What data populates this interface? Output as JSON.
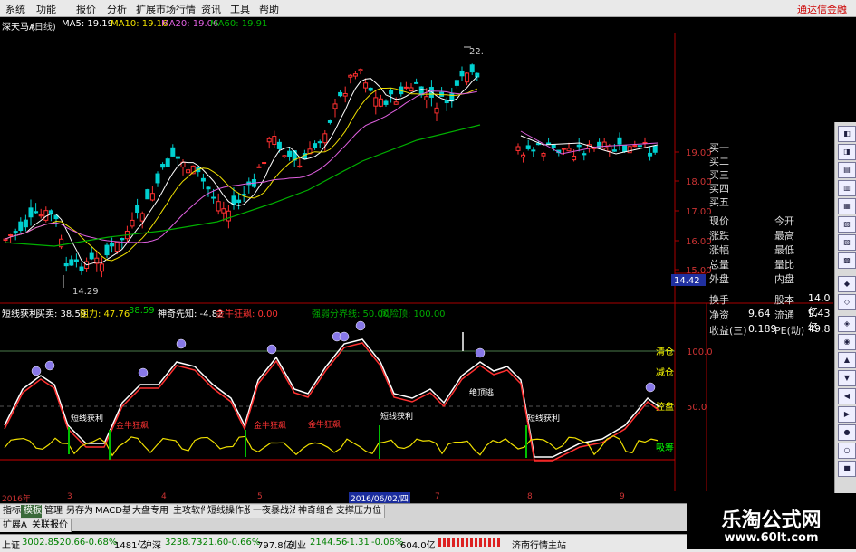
{
  "menu": [
    "系统",
    "功能",
    "报价",
    "分析",
    "扩展市场行情",
    "资讯",
    "工具",
    "帮助"
  ],
  "brand": "通达信金融",
  "title": {
    "stock": "深天马A",
    "period": "(日线)",
    "ma5": "MA5: 19.19",
    "ma10": "MA10: 19.16",
    "ma20": "MA20: 19.06",
    "ma60": "MA60: 19.91"
  },
  "price_axis": [
    "19.00",
    "18.00",
    "17.00",
    "16.00",
    "15.00"
  ],
  "price_current": "14.42",
  "annotations": {
    "low": "14.29",
    "high": "22."
  },
  "indicator_header": {
    "name": "短线获利",
    "buy_sell": "买卖: 38.59",
    "resistance": "阻力: 47.76",
    "v3": "38.59",
    "foresee": "神奇先知: -4.82",
    "golden_bull": "金牛狂飙: 0.00",
    "boundary": "强弱分界线: 50.00",
    "risk": "风险顶: 100.00"
  },
  "indicator_axis": [
    "100.0",
    "50.0"
  ],
  "indicator_labels": {
    "clear": "清仓",
    "reduce": "减仓",
    "control": "控盘",
    "absorb": "吸筹"
  },
  "indicator_text": {
    "short_profit": "短线获利",
    "golden_bull": "金牛狂飙",
    "bottom_escape": "绝顶逃"
  },
  "right_panel": {
    "buy_rows": [
      "买一",
      "买二",
      "买三",
      "买四",
      "买五"
    ],
    "rows": [
      [
        "现价",
        "今开"
      ],
      [
        "涨跌",
        "最高"
      ],
      [
        "涨幅",
        "最低"
      ],
      [
        "总量",
        "量比"
      ],
      [
        "外盘",
        "内盘"
      ]
    ],
    "lower": [
      {
        "label": "换手",
        "label2": "股本",
        "value": "14.0亿"
      },
      {
        "label": "净资",
        "value1": "9.64",
        "label2": "流通",
        "value": "9.43亿"
      },
      {
        "label": "收益(三)",
        "value1": "0.189",
        "label2": "PE(动)",
        "value": "49.8"
      }
    ]
  },
  "date_axis": [
    "2016年",
    "3",
    "4",
    "5",
    "2016/06/02/四",
    "7",
    "8",
    "9"
  ],
  "tabs": [
    "指标",
    "模板",
    "管理",
    "另存为",
    "MACD基本",
    "大盘专用",
    "主攻软件",
    "短线操作股",
    "一夜暴战法",
    "神奇组合",
    "支撑压力位"
  ],
  "active_tab": "模板",
  "tabs2": [
    "扩展A",
    "关联报价"
  ],
  "status": {
    "sh_label": "上证",
    "sh_value": "3002.85",
    "sh_change": "-20.66",
    "sh_pct": "-0.68%",
    "sh_amount": "1481亿",
    "sz_label": "沪深",
    "sz_value": "3238.73",
    "sz_change": "-21.60",
    "sz_pct": "-0.66%",
    "sz_amount": "797.8亿",
    "cy_label": "创业",
    "cy_value": "2144.56",
    "cy_change": "-1.31",
    "cy_pct": "-0.06%",
    "cy_amount": "604.0亿",
    "region": "济南行情主站"
  },
  "watermark": {
    "title": "乐淘公式网",
    "url": "www.60lt.com"
  },
  "colors": {
    "up": "#ff3030",
    "down": "#00d0d0",
    "ma5": "#ffffff",
    "ma10": "#f0e000",
    "ma20": "#e060e0",
    "ma60": "#00b000",
    "status_down": "#008000"
  }
}
